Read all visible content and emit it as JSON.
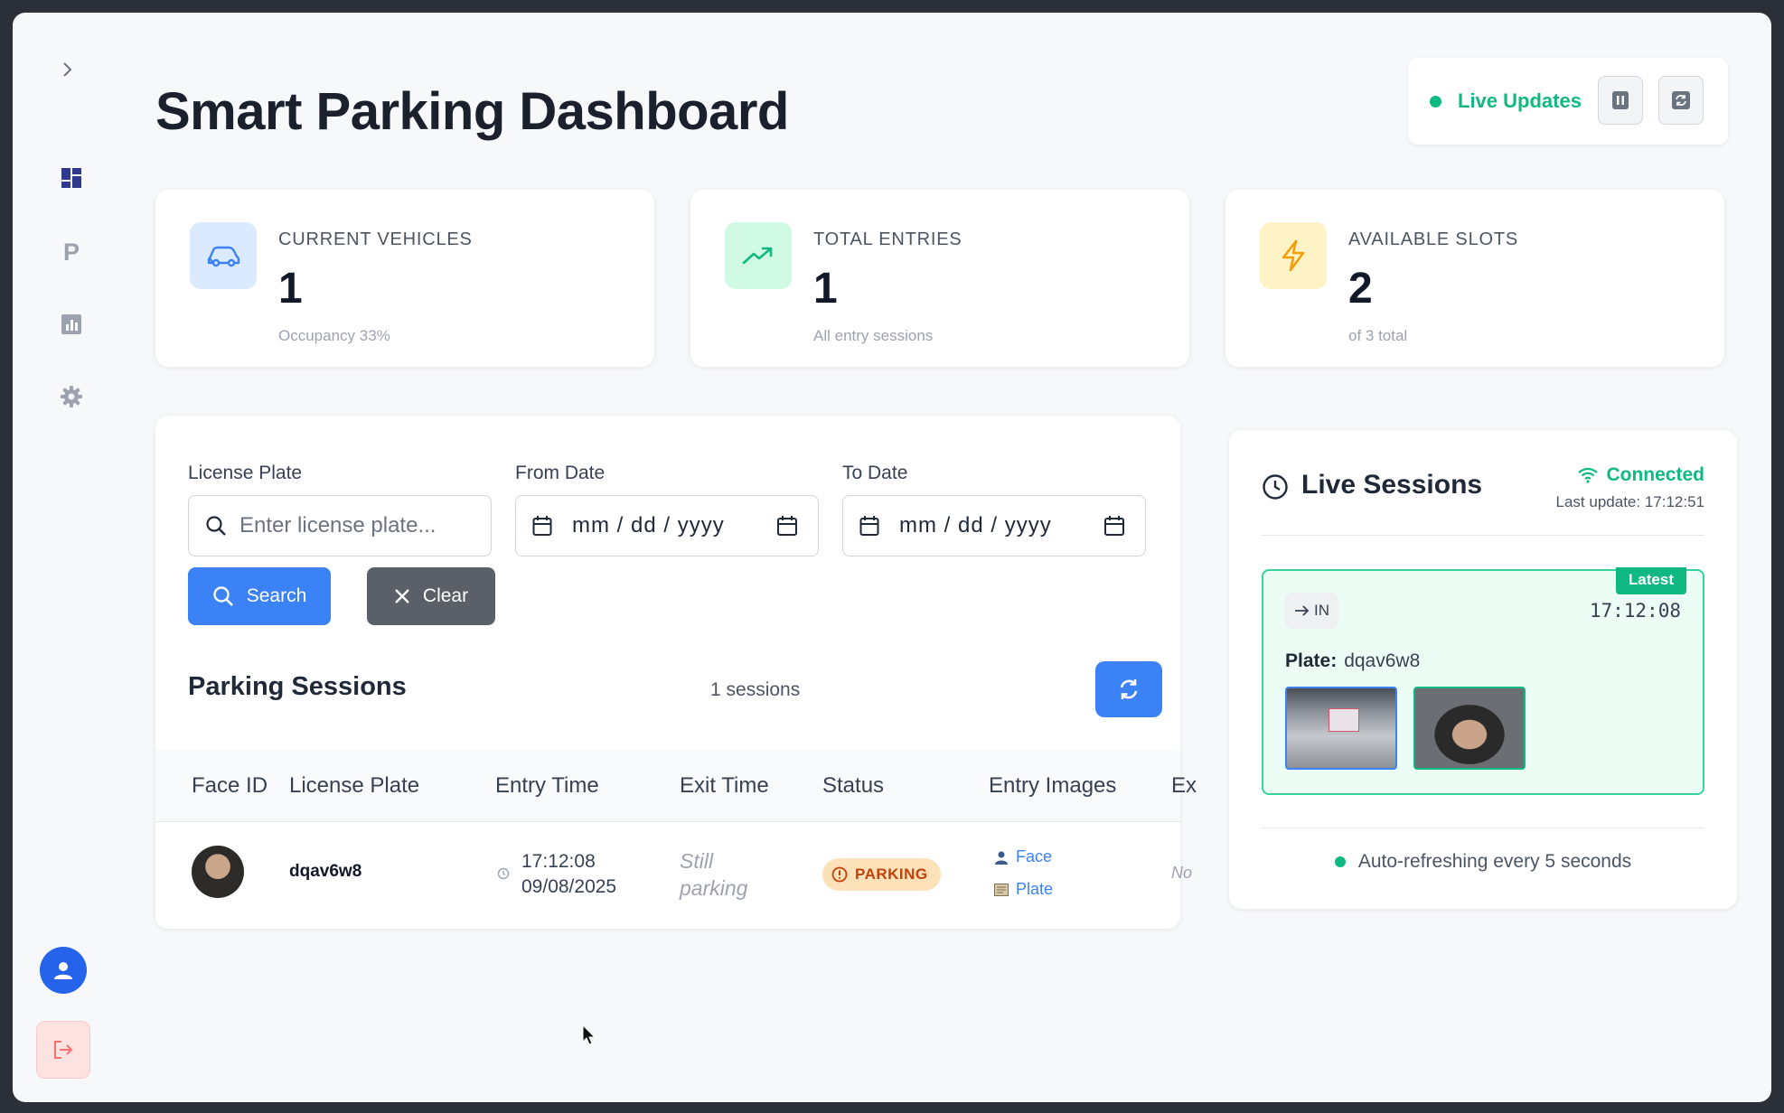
{
  "header": {
    "title": "Smart Parking Dashboard",
    "live_label": "Live Updates"
  },
  "sidebar": {
    "items": [
      "dashboard-icon",
      "parking-icon",
      "chart-icon",
      "gear-icon"
    ],
    "nav_p_letter": "P"
  },
  "stats": [
    {
      "label": "CURRENT VEHICLES",
      "value": "1",
      "sub": "Occupancy 33%",
      "icon": "car-icon",
      "icon_bg": "#dbeafe",
      "icon_color": "#3b82f6"
    },
    {
      "label": "TOTAL ENTRIES",
      "value": "1",
      "sub": "All entry sessions",
      "icon": "trending-up-icon",
      "icon_bg": "#d1fae5",
      "icon_color": "#10b981"
    },
    {
      "label": "AVAILABLE SLOTS",
      "value": "2",
      "sub": "of 3 total",
      "icon": "lightning-icon",
      "icon_bg": "#fef3c7",
      "icon_color": "#f59e0b"
    }
  ],
  "filters": {
    "plate_label": "License Plate",
    "plate_placeholder": "Enter license plate...",
    "from_label": "From Date",
    "from_value": "mm / dd / yyyy",
    "to_label": "To Date",
    "to_value": "mm / dd / yyyy",
    "search_button": "Search",
    "clear_button": "Clear"
  },
  "sessions": {
    "title": "Parking Sessions",
    "count": "1 sessions",
    "columns": [
      "Face ID",
      "License Plate",
      "Entry Time",
      "Exit Time",
      "Status",
      "Entry Images",
      "Ex"
    ],
    "rows": [
      {
        "plate": "dqav6w8",
        "entry_time": "17:12:08",
        "entry_date": "09/08/2025",
        "exit_line1": "Still",
        "exit_line2": "parking",
        "status": "PARKING",
        "img_face": "Face",
        "img_plate": "Plate",
        "exit_images": "No"
      }
    ]
  },
  "live": {
    "title": "Live Sessions",
    "connection": "Connected",
    "last_update": "Last update: 17:12:51",
    "badge": "Latest",
    "direction": "IN",
    "time": "17:12:08",
    "plate_label": "Plate:",
    "plate_value": "dqav6w8",
    "auto_refresh": "Auto-refreshing every 5 seconds"
  },
  "colors": {
    "accent": "#3b82f6",
    "success": "#10b981",
    "warning": "#c2410c"
  }
}
